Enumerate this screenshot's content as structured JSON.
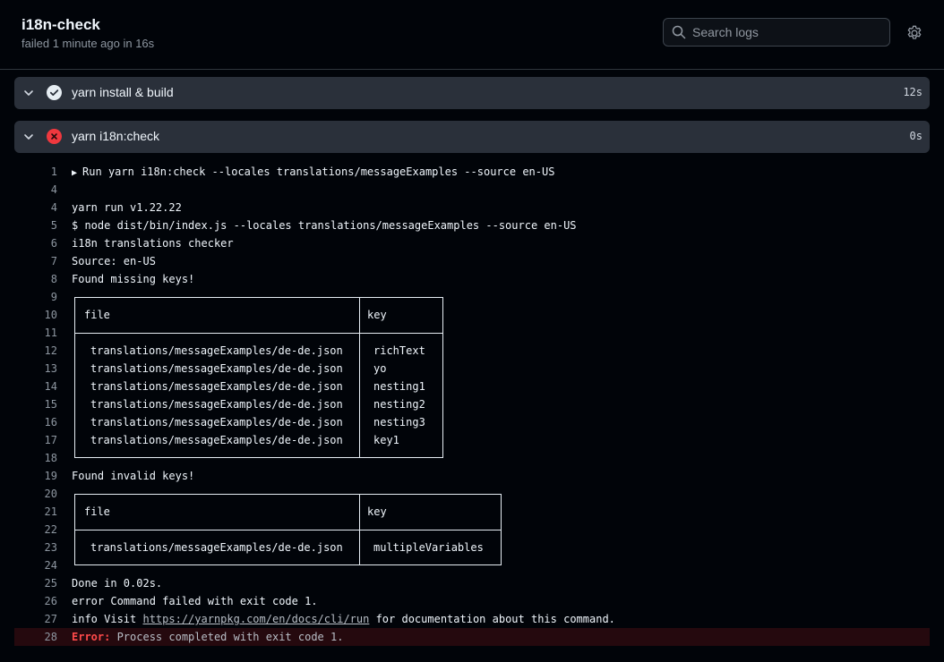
{
  "header": {
    "title": "i18n-check",
    "subtitle": "failed 1 minute ago in 16s",
    "search_placeholder": "Search logs"
  },
  "steps": [
    {
      "name": "yarn install & build",
      "status": "success",
      "duration": "12s"
    },
    {
      "name": "yarn i18n:check",
      "status": "failure",
      "duration": "0s"
    }
  ],
  "log": {
    "lines": [
      {
        "n": "1",
        "text": "Run yarn i18n:check --locales translations/messageExamples --source en-US",
        "collapsible": true
      },
      {
        "n": "4",
        "text": ""
      },
      {
        "n": "4",
        "text": "yarn run v1.22.22"
      },
      {
        "n": "5",
        "text": "$ node dist/bin/index.js --locales translations/messageExamples --source en-US"
      },
      {
        "n": "6",
        "text": "i18n translations checker"
      },
      {
        "n": "7",
        "text": "Source: en-US"
      },
      {
        "n": "8",
        "text": "Found missing keys!"
      },
      {
        "n": "9",
        "text": ""
      },
      {
        "n": "10",
        "text": ""
      },
      {
        "n": "11",
        "text": ""
      },
      {
        "n": "12",
        "text": ""
      },
      {
        "n": "13",
        "text": ""
      },
      {
        "n": "14",
        "text": ""
      },
      {
        "n": "15",
        "text": ""
      },
      {
        "n": "16",
        "text": ""
      },
      {
        "n": "17",
        "text": ""
      },
      {
        "n": "18",
        "text": ""
      },
      {
        "n": "19",
        "text": "Found invalid keys!"
      },
      {
        "n": "20",
        "text": ""
      },
      {
        "n": "21",
        "text": ""
      },
      {
        "n": "22",
        "text": ""
      },
      {
        "n": "23",
        "text": ""
      },
      {
        "n": "24",
        "text": ""
      },
      {
        "n": "25",
        "text": "Done in 0.02s."
      },
      {
        "n": "26",
        "text": "error Command failed with exit code 1."
      },
      {
        "n": "27",
        "text": ""
      },
      {
        "n": "28",
        "text": ""
      }
    ],
    "line27": {
      "prefix": "info Visit ",
      "link": "https://yarnpkg.com/en/docs/cli/run",
      "suffix": " for documentation about this command."
    },
    "line28": {
      "label": "Error:",
      "message": " Process completed with exit code 1."
    },
    "missing_table": {
      "headers": [
        "file",
        "key"
      ],
      "rows": [
        [
          "translations/messageExamples/de-de.json",
          "richText"
        ],
        [
          "translations/messageExamples/de-de.json",
          "yo"
        ],
        [
          "translations/messageExamples/de-de.json",
          "nesting1"
        ],
        [
          "translations/messageExamples/de-de.json",
          "nesting2"
        ],
        [
          "translations/messageExamples/de-de.json",
          "nesting3"
        ],
        [
          "translations/messageExamples/de-de.json",
          "key1"
        ]
      ]
    },
    "invalid_table": {
      "headers": [
        "file",
        "key"
      ],
      "rows": [
        [
          "translations/messageExamples/de-de.json",
          "multipleVariables"
        ]
      ]
    }
  },
  "colors": {
    "error": "#ff4a4a",
    "success": "#e6edf3",
    "failure_bg": "#f0383e"
  }
}
